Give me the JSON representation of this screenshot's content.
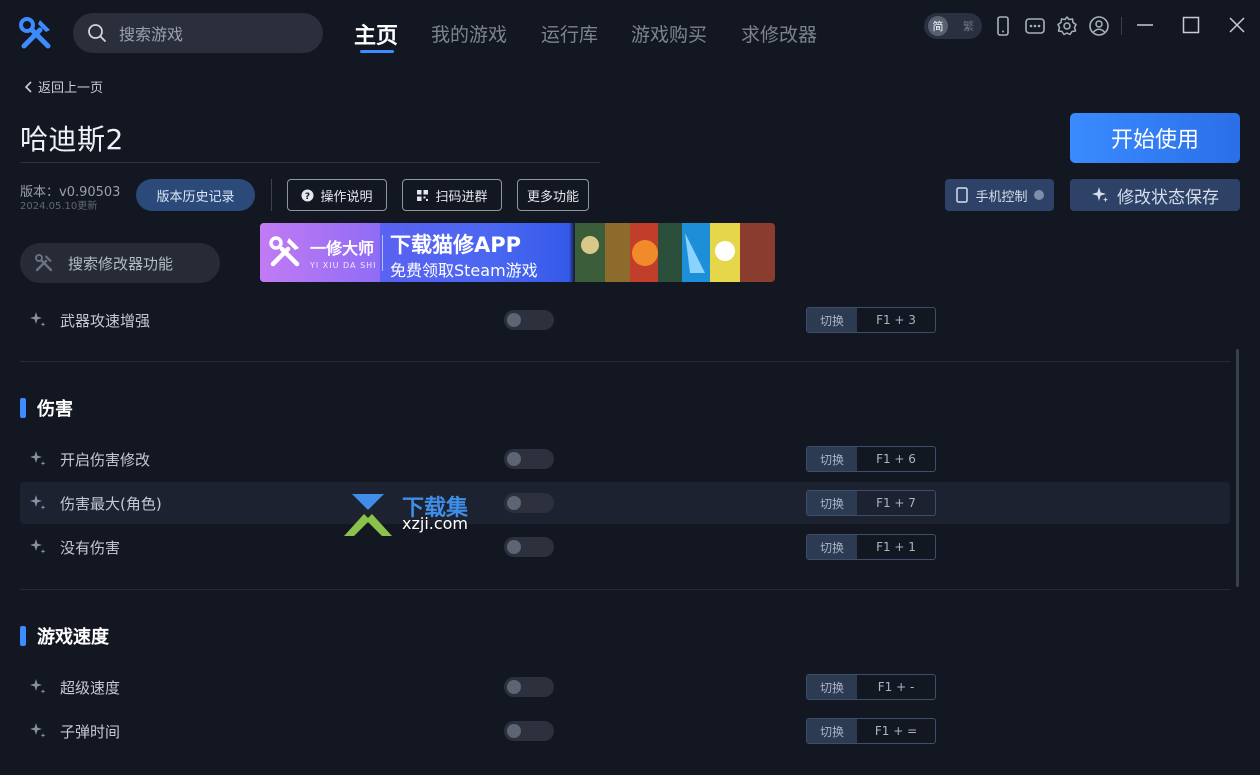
{
  "search": {
    "placeholder": "搜索游戏"
  },
  "nav": {
    "tabs": [
      {
        "label": "主页",
        "active": true
      },
      {
        "label": "我的游戏"
      },
      {
        "label": "运行库"
      },
      {
        "label": "游戏购买"
      },
      {
        "label": "求修改器"
      }
    ]
  },
  "topbar": {
    "lang_active": "简",
    "lang_inactive": "繁",
    "icons": [
      "phone-icon",
      "chat-icon",
      "settings-icon",
      "user-icon"
    ],
    "window_controls": [
      "minimize-icon",
      "maximize-icon",
      "close-icon"
    ]
  },
  "header": {
    "back_label": "返回上一页",
    "title": "哈迪斯2",
    "version": "版本：v0.90503",
    "version_date": "2024.05.10更新",
    "history_btn": "版本历史记录",
    "help_btn": "操作说明",
    "qr_btn": "扫码进群",
    "more_btn": "更多功能",
    "start_btn": "开始使用",
    "mobile_btn": "手机控制",
    "save_state_btn": "修改状态保存"
  },
  "mod_search": {
    "placeholder": "搜索修改器功能"
  },
  "banner": {
    "brand": "一修大师",
    "brand_sub": "YI XIU DA SHI",
    "headline": "下载猫修APP",
    "subline": "免费领取Steam游戏"
  },
  "rows_top": [
    {
      "label": "武器攻速增强",
      "mode": "切换",
      "key": "F1 + 3"
    }
  ],
  "sections": [
    {
      "title": "伤害",
      "rows": [
        {
          "label": "开启伤害修改",
          "mode": "切换",
          "key": "F1 + 6"
        },
        {
          "label": "伤害最大(角色)",
          "mode": "切换",
          "key": "F1 + 7"
        },
        {
          "label": "没有伤害",
          "mode": "切换",
          "key": "F1 + 1"
        }
      ]
    },
    {
      "title": "游戏速度",
      "rows": [
        {
          "label": "超级速度",
          "mode": "切换",
          "key": "F1 + -"
        },
        {
          "label": "子弹时间",
          "mode": "切换",
          "key": "F1 + ="
        }
      ]
    }
  ],
  "watermark": {
    "cn": "下载集",
    "en": "xzji.com"
  },
  "colors": {
    "accent": "#3d8bff",
    "background": "#131722",
    "button_blue": "#2b6fe8"
  }
}
